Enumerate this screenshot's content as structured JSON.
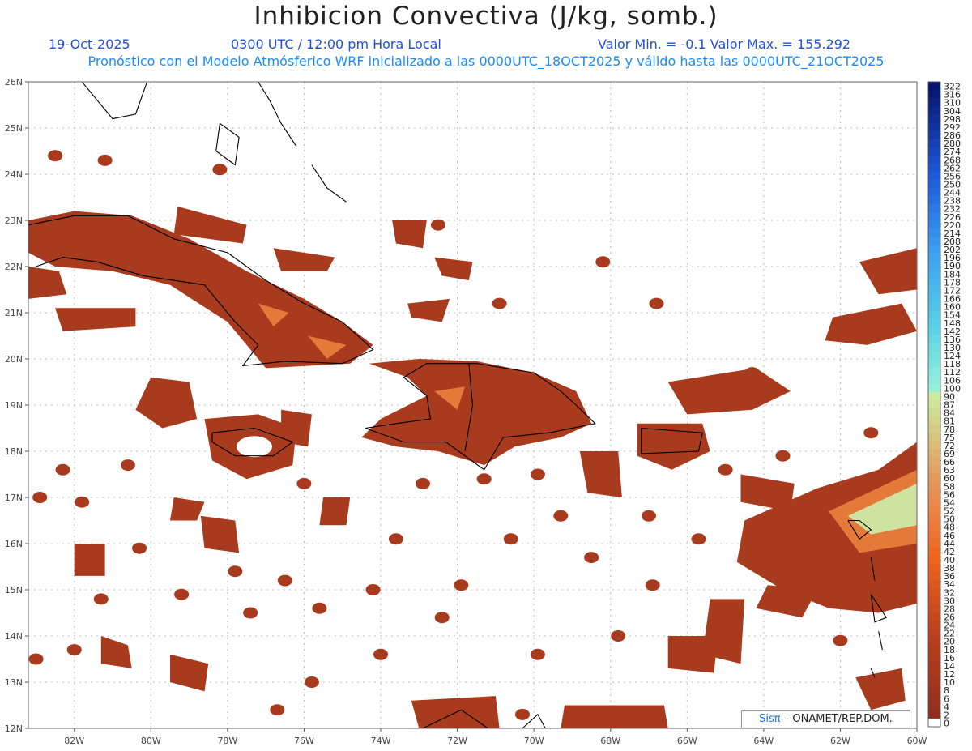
{
  "title": "Inhibicion Convectiva (J/kg, somb.)",
  "header": {
    "date": "19-Oct-2025",
    "time": "0300 UTC / 12:00 pm Hora Local",
    "range": "Valor Min. = -0.1  Valor Max. = 155.292",
    "model": "Pronóstico con el Modelo Atmósferico WRF inicializado a las 0000UTC_18OCT2025 y válido hasta las  0000UTC_21OCT2025"
  },
  "map": {
    "lat_labels": [
      "26N",
      "25N",
      "24N",
      "23N",
      "22N",
      "21N",
      "20N",
      "19N",
      "18N",
      "17N",
      "16N",
      "15N",
      "14N",
      "13N",
      "12N"
    ],
    "lon_labels": [
      "82W",
      "80W",
      "78W",
      "76W",
      "74W",
      "72W",
      "70W",
      "68W",
      "66W",
      "64W",
      "62W",
      "60W"
    ],
    "lat_range": [
      12,
      26
    ],
    "lon_range": [
      -83.2,
      -60
    ],
    "field_color": "#a83a1e",
    "coast_color": "#000000"
  },
  "colorbar": {
    "labels": [
      "322",
      "316",
      "310",
      "304",
      "298",
      "292",
      "286",
      "280",
      "274",
      "268",
      "262",
      "256",
      "250",
      "244",
      "238",
      "232",
      "226",
      "220",
      "214",
      "208",
      "202",
      "196",
      "190",
      "184",
      "178",
      "172",
      "166",
      "160",
      "154",
      "148",
      "142",
      "136",
      "130",
      "124",
      "118",
      "112",
      "106",
      "100",
      "90",
      "87",
      "84",
      "81",
      "78",
      "75",
      "72",
      "69",
      "66",
      "63",
      "60",
      "58",
      "56",
      "54",
      "52",
      "50",
      "48",
      "46",
      "44",
      "42",
      "40",
      "38",
      "36",
      "34",
      "32",
      "30",
      "28",
      "26",
      "24",
      "22",
      "20",
      "18",
      "16",
      "14",
      "12",
      "10",
      "8",
      "6",
      "4",
      "2",
      "0"
    ]
  },
  "credit": {
    "logo": "Sisπ",
    "text": "– ONAMET/REP.DOM."
  }
}
